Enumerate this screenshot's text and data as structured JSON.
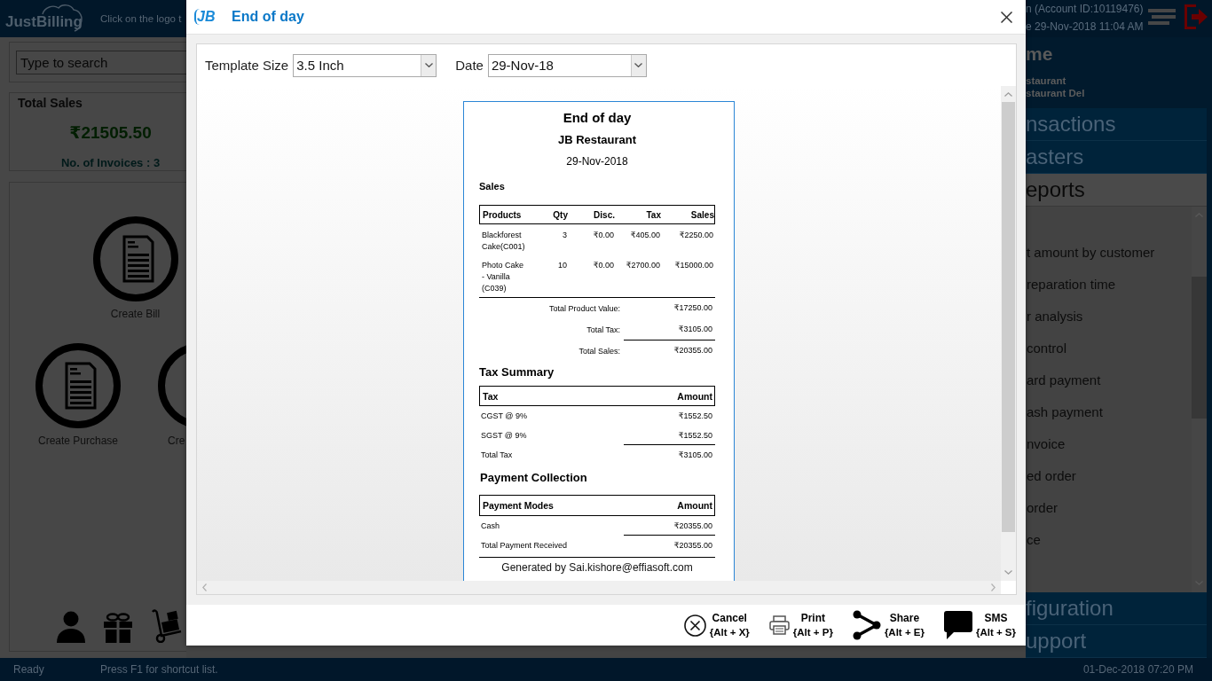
{
  "app": {
    "logo": "JustBilling",
    "hint": "Click on the logo t",
    "account": "n (Account ID:10119476)",
    "login_time": "e 29-Nov-2018 11:04 AM"
  },
  "search": {
    "placeholder": "Type to search"
  },
  "summary": {
    "title": "Total Sales",
    "amount": "₹21505.50",
    "invoices": "No. of Invoices : 3"
  },
  "shortcuts": [
    {
      "label": "Create Bill"
    },
    {
      "label": "Create Purchase"
    },
    {
      "label": "Cre"
    }
  ],
  "right_panel": {
    "heading": "me",
    "outlets": [
      "staurant",
      "staurant Del"
    ],
    "sections": [
      {
        "label": "nsactions",
        "expanded": false
      },
      {
        "label": "asters",
        "expanded": false
      },
      {
        "label": "eports",
        "expanded": true,
        "items": [
          "t amount by customer",
          "reparation time",
          "r analysis",
          "control",
          "ard payment",
          "ash payment",
          "nvoice",
          "ed order",
          "order",
          "ce"
        ]
      },
      {
        "label": "figuration",
        "expanded": false
      },
      {
        "label": "upport",
        "expanded": false
      }
    ]
  },
  "status_bar": {
    "state": "Ready",
    "hint": "Press F1 for shortcut list.",
    "datetime": "01-Dec-2018 07:20 PM"
  },
  "dialog": {
    "logo": "JB",
    "title": "End of day",
    "fields": [
      {
        "label": "Template Size",
        "value": "3.5 Inch"
      },
      {
        "label": "Date",
        "value": "29-Nov-18"
      }
    ],
    "receipt": {
      "title": "End of day",
      "business": "JB Restaurant",
      "date": "29-Nov-2018",
      "sales": {
        "heading": "Sales",
        "columns": [
          "Products",
          "Qty",
          "Disc.",
          "Tax",
          "Sales"
        ],
        "rows": [
          [
            "Blackforest Cake(C001)",
            "3",
            "₹0.00",
            "₹405.00",
            "₹2250.00"
          ],
          [
            "Photo Cake - Vanilla (C039)",
            "10",
            "₹0.00",
            "₹2700.00",
            "₹15000.00"
          ]
        ],
        "totals": [
          {
            "label": "Total Product Value:",
            "value": "₹17250.00"
          },
          {
            "label": "Total Tax:",
            "value": "₹3105.00"
          },
          {
            "label": "Total Sales:",
            "value": "₹20355.00"
          }
        ]
      },
      "tax_summary": {
        "heading": "Tax Summary",
        "columns": [
          "Tax",
          "Amount"
        ],
        "rows": [
          [
            "CGST @ 9%",
            "₹1552.50"
          ],
          [
            "SGST @ 9%",
            "₹1552.50"
          ]
        ],
        "total": {
          "label": "Total Tax",
          "value": "₹3105.00"
        }
      },
      "payment": {
        "heading": "Payment Collection",
        "columns": [
          "Payment Modes",
          "Amount"
        ],
        "rows": [
          [
            "Cash",
            "₹20355.00"
          ]
        ],
        "total": {
          "label": "Total Payment Received",
          "value": "₹20355.00"
        }
      },
      "footer": "Generated by Sai.kishore@effiasoft.com"
    },
    "actions": [
      {
        "kind": "cancel",
        "label": "Cancel",
        "shortcut": "{Alt + X}"
      },
      {
        "kind": "print",
        "label": "Print",
        "shortcut": "{Alt + P}"
      },
      {
        "kind": "share",
        "label": "Share",
        "shortcut": "{Alt + E}"
      },
      {
        "kind": "sms",
        "label": "SMS",
        "shortcut": "{Alt + S}"
      }
    ]
  }
}
